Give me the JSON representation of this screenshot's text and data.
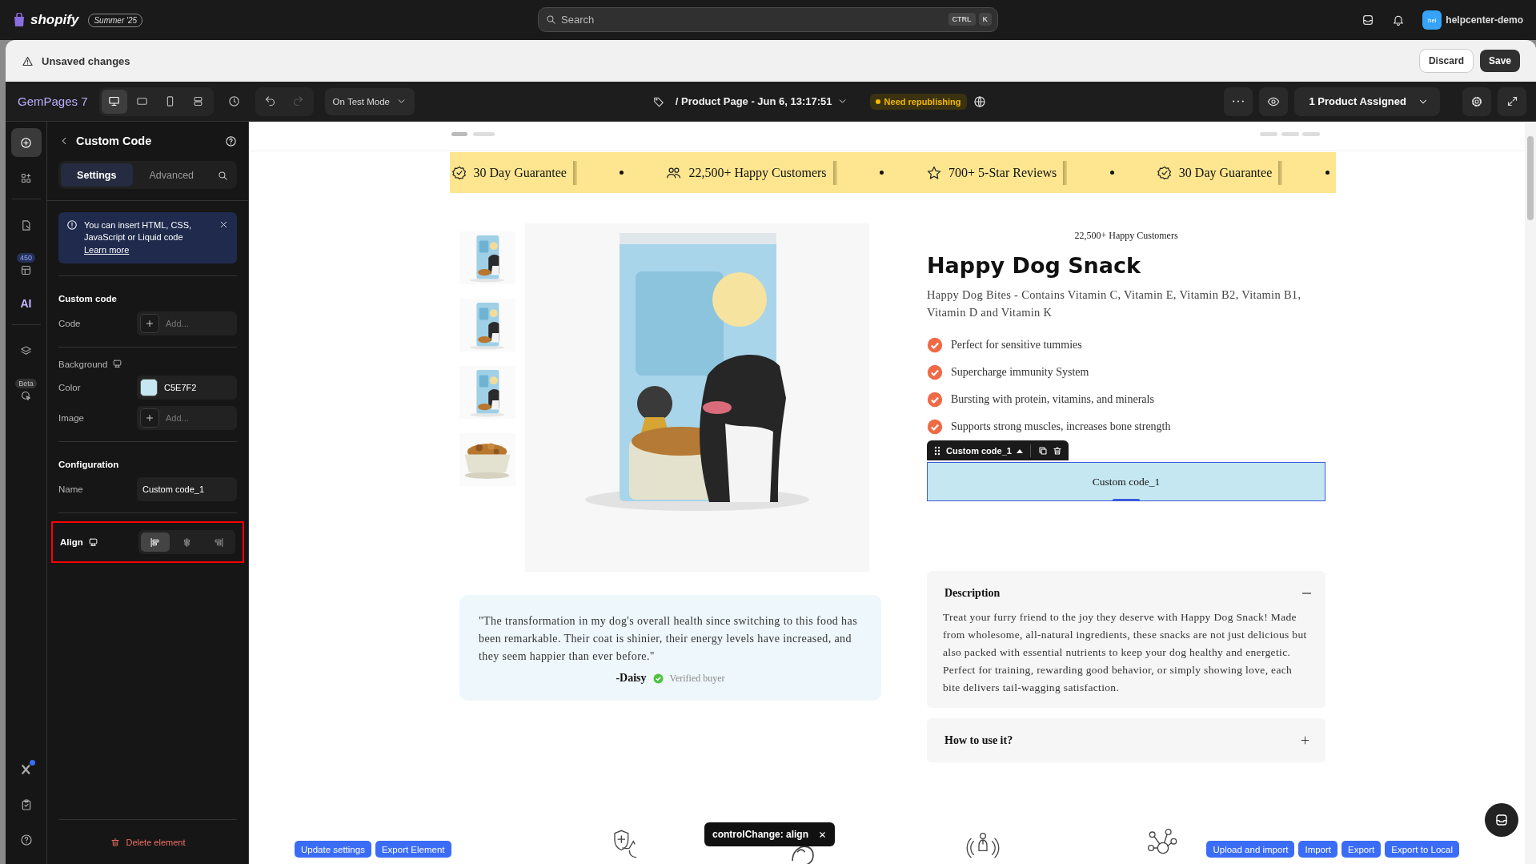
{
  "shopify_bar": {
    "brand": "shopify",
    "edition": "Summer '25",
    "search": {
      "placeholder": "Search"
    },
    "shortcut_keys": [
      "CTRL",
      "K"
    ],
    "store": {
      "initials": "hel",
      "name": "helpcenter-demo"
    }
  },
  "unsaved_bar": {
    "message": "Unsaved changes",
    "buttons": [
      {
        "label": "Discard",
        "kind": "secondary"
      },
      {
        "label": "Save",
        "kind": "primary"
      }
    ]
  },
  "toolbar": {
    "app_name": "GemPages 7",
    "devices": [
      {
        "kind": "desktop",
        "selected": true
      },
      {
        "kind": "tablet",
        "selected": false
      },
      {
        "kind": "mobile",
        "selected": false
      },
      {
        "kind": "split",
        "selected": false
      }
    ],
    "undo": {
      "disabled": false
    },
    "redo": {
      "disabled": true
    },
    "mode": "On Test Mode",
    "page_title": "/ Product Page - Jun 6, 13:17:51",
    "status": "Need republishing",
    "assigned": "1 Product Assigned"
  },
  "rail": {
    "items": [
      {
        "kind": "insert",
        "selected": true
      },
      {
        "kind": "apps",
        "selected": false
      },
      {
        "kind": "pages",
        "selected": false
      },
      {
        "kind": "layout",
        "badge": "450",
        "selected": false
      },
      {
        "kind": "ai",
        "label": "AI",
        "selected": false
      },
      {
        "kind": "layers",
        "selected": false
      },
      {
        "kind": "inspect",
        "badge": "Beta",
        "selected": false
      }
    ],
    "bottom_items": [
      {
        "kind": "x-app",
        "notification": true
      },
      {
        "kind": "checklist"
      },
      {
        "kind": "help"
      }
    ]
  },
  "panel": {
    "title": "Custom Code",
    "tabs": [
      {
        "label": "Settings",
        "selected": true
      },
      {
        "label": "Advanced",
        "selected": false
      }
    ],
    "notice": {
      "text": "You can insert HTML, CSS, JavaScript or Liquid code",
      "link": "Learn more"
    },
    "sections": [
      {
        "heading": "Custom code",
        "kind": "group",
        "fields": [
          {
            "label": "Code",
            "kind": "add",
            "placeholder": "Add..."
          }
        ]
      },
      {
        "heading": "Background",
        "kind": "subgroup",
        "fields": [
          {
            "label": "Color",
            "kind": "color",
            "value": "C5E7F2"
          },
          {
            "label": "Image",
            "kind": "add",
            "placeholder": "Add..."
          }
        ]
      },
      {
        "heading": "Configuration",
        "kind": "group",
        "fields": [
          {
            "label": "Name",
            "kind": "text",
            "value": "Custom code_1"
          }
        ]
      }
    ],
    "align": {
      "label": "Align",
      "options": [
        {
          "kind": "left",
          "selected": true
        },
        {
          "kind": "center",
          "selected": false
        },
        {
          "kind": "right",
          "selected": false
        }
      ]
    },
    "delete_label": "Delete element"
  },
  "canvas": {
    "banner": [
      {
        "kind": "badge",
        "text": "30 Day Guarantee"
      },
      {
        "kind": "people",
        "text": "22,500+ Happy Customers"
      },
      {
        "kind": "star",
        "text": "700+ 5-Star Reviews"
      },
      {
        "kind": "badge",
        "text": "30 Day Guarantee"
      }
    ],
    "product": {
      "thumbnails": [
        {
          "kind": "bag"
        },
        {
          "kind": "bag"
        },
        {
          "kind": "bag"
        },
        {
          "kind": "bowl"
        }
      ],
      "eyebrow": "22,500+ Happy Customers",
      "title": "Happy Dog Snack",
      "subtitle": "Happy Dog Bites - Contains Vitamin C, Vitamin E, Vitamin B2, Vitamin B1, Vitamin D and Vitamin K",
      "benefits": [
        "Perfect for sensitive tummies",
        "Supercharge immunity System",
        "Bursting with protein, vitamins, and minerals",
        "Supports strong muscles, increases bone strength"
      ],
      "custom_block": {
        "toolbar_label": "Custom code_1",
        "text": "Custom code_1"
      },
      "testimonial": {
        "quote": "\"The transformation in my dog's overall health since switching to this food has been remarkable. Their coat is shinier, their energy levels have increased, and they seem happier than ever before.\"",
        "author": "-Daisy",
        "badge": "Verified buyer"
      },
      "accordions": [
        {
          "title": "Description",
          "expanded": true,
          "body": "Treat your furry friend to the joy they deserve with Happy Dog Snack! Made from wholesome, all-natural ingredients, these snacks are not just delicious but also packed with essential nutrients to keep your dog healthy and energetic. Perfect for training, rewarding good behavior, or simply showing love, each bite delivers tail-wagging satisfaction."
        },
        {
          "title": "How to use it?",
          "expanded": false
        }
      ]
    },
    "features": [
      {
        "kind": "shield"
      },
      {
        "kind": "animal"
      },
      {
        "kind": "figure"
      },
      {
        "kind": "network"
      }
    ]
  },
  "overlay": {
    "left_buttons": [
      "Update settings",
      "Export Element"
    ],
    "right_buttons": [
      "Upload and import",
      "Import",
      "Export",
      "Export to Local"
    ],
    "toast": "controlChange: align"
  }
}
